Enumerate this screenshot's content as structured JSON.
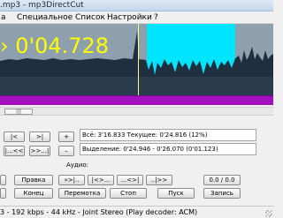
{
  "window": {
    "title": ".mp3 - mp3DirectCut"
  },
  "menu": {
    "items": [
      "а",
      "Специальное",
      "Список",
      "Настройки",
      "?"
    ]
  },
  "display": {
    "time": "› 0'04.728",
    "colors": {
      "wave": "#8ea0ad",
      "selection": "#00e5ff",
      "time": "#ffff00",
      "bar": "#a10fbf"
    }
  },
  "scroll": {
    "thumb_label": "|||"
  },
  "nav_buttons": {
    "prev_cue": "|<",
    "next_cue": ">|",
    "back": "|...<<",
    "forward": ">>...|",
    "plus": "+",
    "minus": "–"
  },
  "info": {
    "total": "Всё: 3'16.833   Текущее: 0'24.816  (12%)",
    "selection": "Выделение: 0'24.946 - 0'26.070 (0'01.123)"
  },
  "audio_label": "Аудио:",
  "play_buttons": {
    "b1": "»>|..",
    "b2": "|<>...",
    "b3": "...<>|",
    "b4": "..|>>",
    "b5": "0.0 / 0.0"
  },
  "actions": {
    "edit": "Правка",
    "end": "Конец",
    "rewind": "Перемотка",
    "stop": "Стоп",
    "play": "Пуск",
    "record": "Запись"
  },
  "status": "3 - 192 kbps - 44 kHz - Joint Stereo  (Play decoder: ACM)"
}
